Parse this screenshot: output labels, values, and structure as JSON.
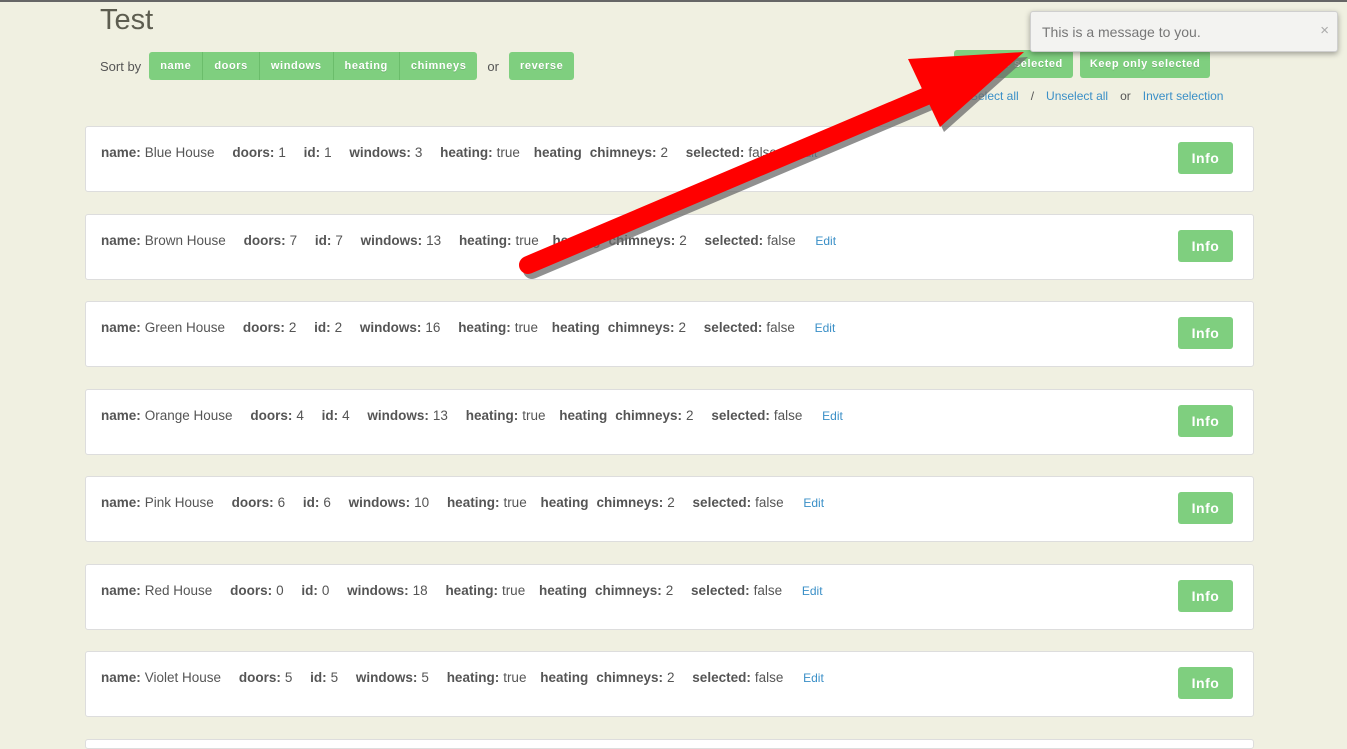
{
  "page": {
    "title": "Test"
  },
  "sort": {
    "label": "Sort by",
    "options": [
      "name",
      "doors",
      "windows",
      "heating",
      "chimneys"
    ],
    "or": "or",
    "reverse": "reverse"
  },
  "actions": {
    "remove_selected": "Remove selected",
    "keep_only_selected": "Keep only selected",
    "select_all": "Select all",
    "slash": "/",
    "unselect_all": "Unselect all",
    "or": "or",
    "invert_selection": "Invert selection"
  },
  "labels": {
    "name": "name:",
    "doors": "doors:",
    "id": "id:",
    "windows": "windows:",
    "heating": "heating:",
    "heating_chimneys": "heating",
    "chimneys": "chimneys:",
    "selected": "selected:",
    "edit": "Edit",
    "info": "Info"
  },
  "houses": [
    {
      "name": "Blue House",
      "doors": "1",
      "id": "1",
      "windows": "3",
      "heating": "true",
      "chimneys": "2",
      "selected": "false"
    },
    {
      "name": "Brown House",
      "doors": "7",
      "id": "7",
      "windows": "13",
      "heating": "true",
      "chimneys": "2",
      "selected": "false"
    },
    {
      "name": "Green House",
      "doors": "2",
      "id": "2",
      "windows": "16",
      "heating": "true",
      "chimneys": "2",
      "selected": "false"
    },
    {
      "name": "Orange House",
      "doors": "4",
      "id": "4",
      "windows": "13",
      "heating": "true",
      "chimneys": "2",
      "selected": "false"
    },
    {
      "name": "Pink House",
      "doors": "6",
      "id": "6",
      "windows": "10",
      "heating": "true",
      "chimneys": "2",
      "selected": "false"
    },
    {
      "name": "Red House",
      "doors": "0",
      "id": "0",
      "windows": "18",
      "heating": "true",
      "chimneys": "2",
      "selected": "false"
    },
    {
      "name": "Violet House",
      "doors": "5",
      "id": "5",
      "windows": "5",
      "heating": "true",
      "chimneys": "2",
      "selected": "false"
    }
  ],
  "toast": {
    "message": "This is a message to you.",
    "close": "×"
  },
  "colors": {
    "background": "#f0f0e1",
    "button": "#7fcf7f",
    "link": "#3a8fc7",
    "arrow": "#ff0000"
  }
}
